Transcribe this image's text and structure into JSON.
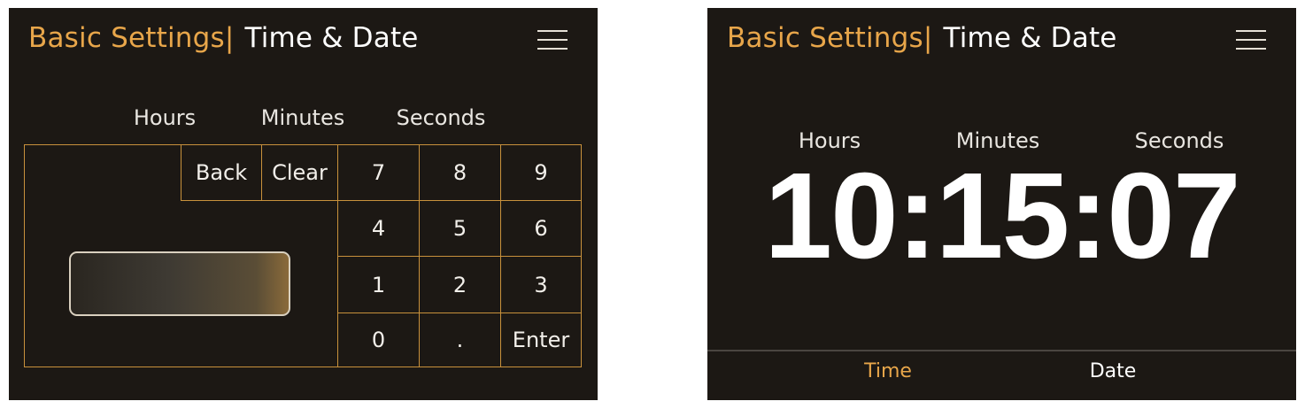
{
  "colors": {
    "accent": "#e8a64a",
    "background": "#1c1814",
    "grid_line": "#c8913c"
  },
  "left": {
    "title": {
      "main": "Basic Settings",
      "separator": "|",
      "sub": "Time & Date"
    },
    "menu_icon": "hamburger-menu-icon",
    "headers": {
      "hours": "Hours",
      "minutes": "Minutes",
      "seconds": "Seconds"
    },
    "keypad": {
      "back": "Back",
      "clear": "Clear",
      "k7": "7",
      "k8": "8",
      "k9": "9",
      "k4": "4",
      "k5": "5",
      "k6": "6",
      "k1": "1",
      "k2": "2",
      "k3": "3",
      "k0": "0",
      "dot": ".",
      "enter": "Enter"
    },
    "display_value": ""
  },
  "right": {
    "title": {
      "main": "Basic Settings",
      "separator": "|",
      "sub": "Time & Date"
    },
    "menu_icon": "hamburger-menu-icon",
    "headers": {
      "hours": "Hours",
      "minutes": "Minutes",
      "seconds": "Seconds"
    },
    "time": "10:15:07",
    "tabs": {
      "time": "Time",
      "date": "Date",
      "active": "time"
    }
  }
}
